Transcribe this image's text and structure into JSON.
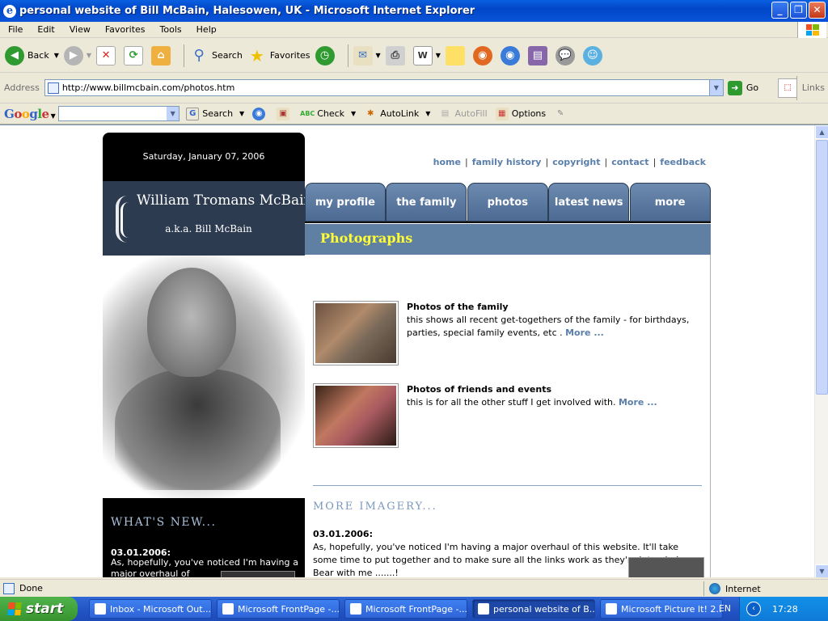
{
  "window": {
    "title": "personal website of Bill McBain, Halesowen, UK - Microsoft Internet Explorer"
  },
  "menu": [
    "File",
    "Edit",
    "View",
    "Favorites",
    "Tools",
    "Help"
  ],
  "toolbar": {
    "back": "Back",
    "search": "Search",
    "favorites": "Favorites"
  },
  "address": {
    "label": "Address",
    "url": "http://www.billmcbain.com/photos.htm",
    "go": "Go",
    "links": "Links"
  },
  "google": {
    "logo": "Google",
    "search": "Search",
    "check": "Check",
    "autolink": "AutoLink",
    "autofill": "AutoFill",
    "options": "Options"
  },
  "site": {
    "date": "Saturday, January 07, 2006",
    "name": "William Tromans McBain",
    "aka": "a.k.a. Bill McBain",
    "toplinks": [
      "home",
      "family history",
      "copyright",
      "contact",
      "feedback"
    ],
    "tabs": [
      "my profile",
      "the family",
      "photos",
      "latest news",
      "more"
    ],
    "section_title": "Photographs",
    "items": [
      {
        "title": "Photos of the family",
        "text": "this shows all recent get-togethers of the family - for birthdays, parties, special family events, etc .",
        "more": "More ..."
      },
      {
        "title": "Photos of friends and events",
        "text": "this is for all the other stuff I get involved with.",
        "more": "More ..."
      }
    ],
    "more_imagery": "MORE IMAGERY...",
    "news_heading": "WHAT'S NEW...",
    "news_date": "03.01.2006:",
    "news_text_left": "As, hopefully, you've noticed I'm having a major overhaul of",
    "news_text_main": "As, hopefully, you've noticed I'm having a major overhaul of this website. It'll take some time to put together and to make sure all the links work as they're intended. Bear with me .......!"
  },
  "status": {
    "text": "Done",
    "zone": "Internet"
  },
  "taskbar": {
    "start": "start",
    "items": [
      "Inbox - Microsoft Out...",
      "Microsoft FrontPage -...",
      "Microsoft FrontPage -...",
      "personal website of B...",
      "Microsoft Picture It! 2..."
    ],
    "lang": "EN",
    "clock": "17:28"
  },
  "colors": {
    "accent": "#5a7faa",
    "tab": "#5f7fa3",
    "section_title": "#ffff33",
    "brand_bg": "#2d3b50"
  }
}
